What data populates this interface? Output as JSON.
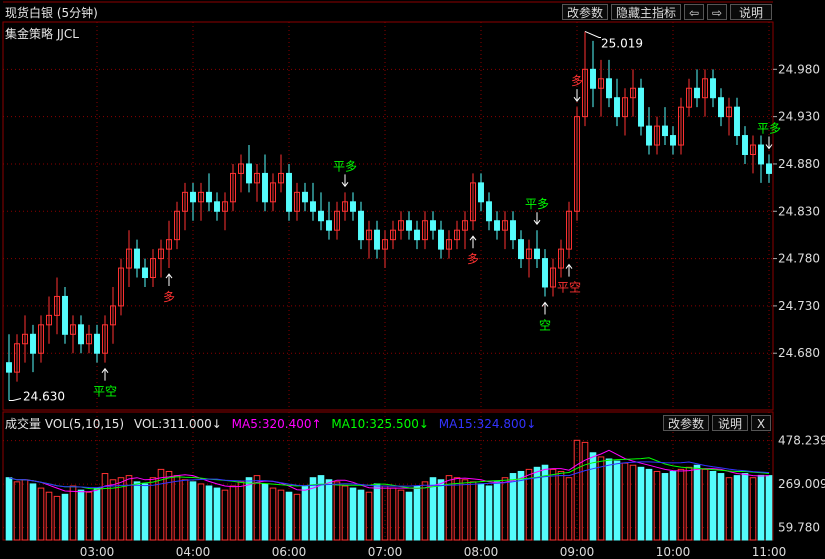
{
  "header": {
    "title": "现货白银 (5分钟)",
    "strategy": "集金策略 JJCL",
    "buttons": {
      "params": "改参数",
      "hide_indicator": "隐藏主指标",
      "prev": "⇦",
      "next": "⇨",
      "help": "说明"
    }
  },
  "volume_panel": {
    "label": "成交量 VOL(5,10,15)",
    "vol": "VOL:311.000↓",
    "ma5": "MA5:320.400↑",
    "ma10": "MA10:325.500↓",
    "ma15": "MA15:324.800↓",
    "buttons": {
      "params": "改参数",
      "help": "说明",
      "close": "X"
    }
  },
  "colors": {
    "up": "#ff3232",
    "down": "#54fcfc",
    "long_signal": "#ff3232",
    "close_signal": "#00ff00",
    "short_signal": "#00ff00",
    "ma5": "#ff00ff",
    "ma10": "#00ff00",
    "ma15": "#3333ff",
    "grid": "#8b0000",
    "background": "#000000"
  },
  "chart_data": [
    {
      "type": "candlestick",
      "y_ticks": [
        24.98,
        24.93,
        24.88,
        24.83,
        24.78,
        24.73,
        24.68
      ],
      "y_tick_labels": [
        "24.980",
        "24.930",
        "24.880",
        "24.830",
        "24.780",
        "24.730",
        "24.680"
      ],
      "ylim": [
        24.62,
        25.03
      ],
      "high_label": "25.019",
      "low_label": "24.630",
      "x_tick_labels": [
        "03:00",
        "04:00",
        "06:00",
        "07:00",
        "08:00",
        "09:00",
        "10:00",
        "11:00"
      ],
      "x_tick_index": [
        11,
        23,
        35,
        47,
        59,
        71,
        83,
        95
      ],
      "signals": [
        {
          "index": 12,
          "label": "平空",
          "dir": "up",
          "color": "short"
        },
        {
          "index": 20,
          "label": "多",
          "dir": "up",
          "color": "long"
        },
        {
          "index": 42,
          "label": "平多",
          "dir": "down",
          "color": "close"
        },
        {
          "index": 58,
          "label": "多",
          "dir": "up",
          "color": "long"
        },
        {
          "index": 66,
          "label": "平多",
          "dir": "down",
          "color": "close"
        },
        {
          "index": 67,
          "label": "空",
          "dir": "up",
          "color": "close"
        },
        {
          "index": 70,
          "label": "平空",
          "dir": "up",
          "color": "long"
        },
        {
          "index": 71,
          "label": "多",
          "dir": "down",
          "color": "long"
        },
        {
          "index": 95,
          "label": "平多",
          "dir": "down",
          "color": "close"
        }
      ],
      "ohlc": [
        [
          24.67,
          24.7,
          24.63,
          24.66
        ],
        [
          24.66,
          24.7,
          24.65,
          24.69
        ],
        [
          24.69,
          24.72,
          24.67,
          24.7
        ],
        [
          24.7,
          24.71,
          24.66,
          24.68
        ],
        [
          24.68,
          24.72,
          24.67,
          24.71
        ],
        [
          24.71,
          24.74,
          24.69,
          24.72
        ],
        [
          24.72,
          24.76,
          24.7,
          24.74
        ],
        [
          24.74,
          24.75,
          24.69,
          24.7
        ],
        [
          24.7,
          24.72,
          24.68,
          24.71
        ],
        [
          24.71,
          24.72,
          24.68,
          24.69
        ],
        [
          24.69,
          24.71,
          24.68,
          24.7
        ],
        [
          24.7,
          24.71,
          24.67,
          24.68
        ],
        [
          24.68,
          24.72,
          24.67,
          24.71
        ],
        [
          24.71,
          24.75,
          24.69,
          24.73
        ],
        [
          24.73,
          24.78,
          24.72,
          24.77
        ],
        [
          24.77,
          24.81,
          24.75,
          24.79
        ],
        [
          24.79,
          24.8,
          24.76,
          24.77
        ],
        [
          24.77,
          24.78,
          24.75,
          24.76
        ],
        [
          24.76,
          24.79,
          24.75,
          24.78
        ],
        [
          24.78,
          24.8,
          24.76,
          24.79
        ],
        [
          24.79,
          24.82,
          24.77,
          24.8
        ],
        [
          24.8,
          24.84,
          24.79,
          24.83
        ],
        [
          24.83,
          24.86,
          24.81,
          24.85
        ],
        [
          24.85,
          24.86,
          24.82,
          24.84
        ],
        [
          24.84,
          24.86,
          24.82,
          24.85
        ],
        [
          24.85,
          24.87,
          24.83,
          24.84
        ],
        [
          24.84,
          24.85,
          24.82,
          24.83
        ],
        [
          24.83,
          24.85,
          24.81,
          24.84
        ],
        [
          24.84,
          24.88,
          24.83,
          24.87
        ],
        [
          24.87,
          24.89,
          24.85,
          24.88
        ],
        [
          24.88,
          24.9,
          24.85,
          24.86
        ],
        [
          24.86,
          24.88,
          24.84,
          24.87
        ],
        [
          24.87,
          24.89,
          24.83,
          24.84
        ],
        [
          24.84,
          24.87,
          24.83,
          24.86
        ],
        [
          24.86,
          24.89,
          24.85,
          24.87
        ],
        [
          24.87,
          24.88,
          24.82,
          24.83
        ],
        [
          24.83,
          24.86,
          24.82,
          24.85
        ],
        [
          24.85,
          24.86,
          24.83,
          24.84
        ],
        [
          24.84,
          24.86,
          24.82,
          24.83
        ],
        [
          24.83,
          24.85,
          24.81,
          24.82
        ],
        [
          24.82,
          24.84,
          24.8,
          24.81
        ],
        [
          24.81,
          24.84,
          24.8,
          24.83
        ],
        [
          24.83,
          24.85,
          24.82,
          24.84
        ],
        [
          24.84,
          24.85,
          24.82,
          24.83
        ],
        [
          24.83,
          24.84,
          24.79,
          24.8
        ],
        [
          24.8,
          24.82,
          24.78,
          24.81
        ],
        [
          24.81,
          24.82,
          24.78,
          24.79
        ],
        [
          24.79,
          24.81,
          24.77,
          24.8
        ],
        [
          24.8,
          24.82,
          24.79,
          24.81
        ],
        [
          24.81,
          24.83,
          24.8,
          24.82
        ],
        [
          24.82,
          24.83,
          24.8,
          24.81
        ],
        [
          24.81,
          24.82,
          24.79,
          24.8
        ],
        [
          24.8,
          24.83,
          24.79,
          24.82
        ],
        [
          24.82,
          24.83,
          24.8,
          24.81
        ],
        [
          24.81,
          24.82,
          24.78,
          24.79
        ],
        [
          24.79,
          24.81,
          24.78,
          24.8
        ],
        [
          24.8,
          24.82,
          24.79,
          24.81
        ],
        [
          24.81,
          24.83,
          24.79,
          24.82
        ],
        [
          24.82,
          24.87,
          24.81,
          24.86
        ],
        [
          24.86,
          24.87,
          24.83,
          24.84
        ],
        [
          24.84,
          24.85,
          24.81,
          24.82
        ],
        [
          24.82,
          24.83,
          24.8,
          24.81
        ],
        [
          24.81,
          24.83,
          24.79,
          24.82
        ],
        [
          24.82,
          24.83,
          24.79,
          24.8
        ],
        [
          24.8,
          24.81,
          24.77,
          24.78
        ],
        [
          24.78,
          24.8,
          24.76,
          24.79
        ],
        [
          24.79,
          24.81,
          24.77,
          24.78
        ],
        [
          24.78,
          24.79,
          24.74,
          24.75
        ],
        [
          24.75,
          24.78,
          24.74,
          24.77
        ],
        [
          24.77,
          24.8,
          24.76,
          24.79
        ],
        [
          24.79,
          24.84,
          24.78,
          24.83
        ],
        [
          24.83,
          24.94,
          24.82,
          24.93
        ],
        [
          24.93,
          25.02,
          24.92,
          24.98
        ],
        [
          24.98,
          25.01,
          24.94,
          24.96
        ],
        [
          24.96,
          24.99,
          24.93,
          24.97
        ],
        [
          24.97,
          24.99,
          24.94,
          24.95
        ],
        [
          24.95,
          24.97,
          24.92,
          24.93
        ],
        [
          24.93,
          24.96,
          24.91,
          24.95
        ],
        [
          24.95,
          24.98,
          24.93,
          24.96
        ],
        [
          24.96,
          24.97,
          24.91,
          24.92
        ],
        [
          24.92,
          24.94,
          24.89,
          24.9
        ],
        [
          24.9,
          24.93,
          24.89,
          24.92
        ],
        [
          24.92,
          24.94,
          24.9,
          24.91
        ],
        [
          24.91,
          24.92,
          24.89,
          24.9
        ],
        [
          24.9,
          24.95,
          24.89,
          24.94
        ],
        [
          24.94,
          24.97,
          24.93,
          24.96
        ],
        [
          24.96,
          24.98,
          24.94,
          24.95
        ],
        [
          24.95,
          24.98,
          24.93,
          24.97
        ],
        [
          24.97,
          24.98,
          24.94,
          24.95
        ],
        [
          24.95,
          24.96,
          24.92,
          24.93
        ],
        [
          24.93,
          24.95,
          24.91,
          24.94
        ],
        [
          24.94,
          24.95,
          24.9,
          24.91
        ],
        [
          24.91,
          24.92,
          24.88,
          24.89
        ],
        [
          24.89,
          24.91,
          24.87,
          24.9
        ],
        [
          24.9,
          24.91,
          24.86,
          24.88
        ],
        [
          24.88,
          24.89,
          24.86,
          24.87
        ]
      ]
    },
    {
      "type": "bar",
      "y_ticks": [
        478.239,
        269.009,
        59.78
      ],
      "y_tick_labels": [
        "478.239",
        "269.009",
        "59.780"
      ],
      "ylim": [
        0,
        520
      ],
      "volumes": [
        300,
        280,
        290,
        270,
        250,
        230,
        210,
        220,
        260,
        240,
        230,
        250,
        320,
        290,
        300,
        310,
        280,
        270,
        300,
        340,
        330,
        310,
        290,
        280,
        270,
        260,
        250,
        240,
        260,
        280,
        300,
        310,
        270,
        250,
        240,
        230,
        220,
        260,
        300,
        310,
        290,
        280,
        260,
        250,
        240,
        230,
        270,
        260,
        250,
        240,
        230,
        260,
        280,
        300,
        290,
        310,
        300,
        290,
        280,
        270,
        260,
        280,
        300,
        320,
        330,
        340,
        350,
        360,
        340,
        330,
        300,
        480,
        470,
        420,
        400,
        390,
        380,
        370,
        360,
        350,
        340,
        330,
        320,
        330,
        340,
        350,
        360,
        340,
        330,
        320,
        300,
        310,
        320,
        300,
        311,
        310
      ],
      "vol_colors": "derived_from_ohlc"
    }
  ]
}
